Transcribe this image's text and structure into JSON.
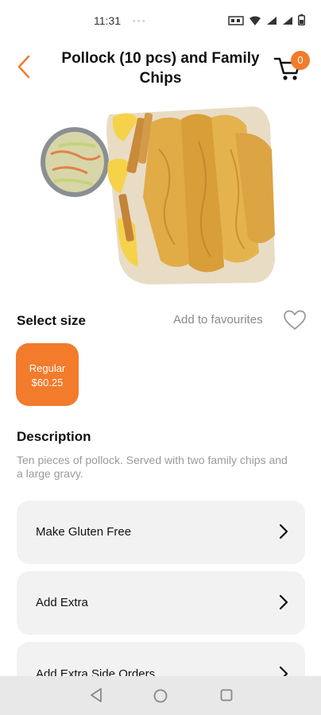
{
  "status": {
    "time": "11:31",
    "dots": "∘∘∘"
  },
  "header": {
    "title": "Pollock (10 pcs) and Family Chips",
    "cart_count": "0"
  },
  "product": {
    "select_size_label": "Select size",
    "favourites_label": "Add to favourites",
    "sizes": [
      {
        "name": "Regular",
        "price": "$60.25"
      }
    ],
    "description_title": "Description",
    "description_text": "Ten pieces of pollock. Served with two family chips and a large gravy."
  },
  "options": [
    {
      "label": "Make Gluten Free"
    },
    {
      "label": "Add Extra"
    },
    {
      "label": "Add Extra Side Orders"
    }
  ],
  "colors": {
    "accent": "#f27b2c",
    "option_bg": "#f2f2f2",
    "muted_text": "#9a9a9a"
  }
}
